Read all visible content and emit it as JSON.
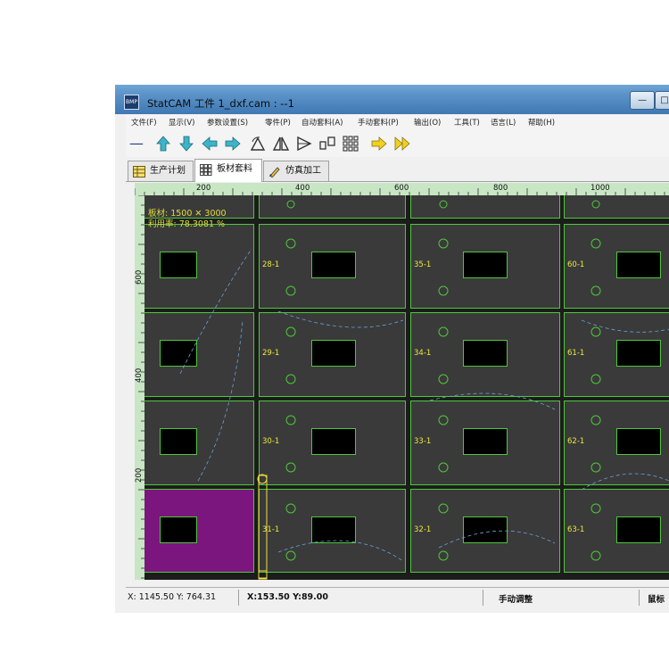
{
  "window": {
    "title": "StatCAM 工件 1_dxf.cam : --1",
    "app_icon_text": "BMP",
    "controls": [
      "—",
      "□"
    ]
  },
  "menu": [
    "文件(F)",
    "显示(V)",
    "参数设置(S)",
    "零件(P)",
    "自动套料(A)",
    "手动套料(P)",
    "输出(O)",
    "工具(T)",
    "语言(L)",
    "帮助(H)"
  ],
  "toolbar": {
    "icons": [
      "minus-icon",
      "arrow-up-icon",
      "arrow-down-icon",
      "arrow-left-icon",
      "arrow-right-icon",
      "rotate-triangle-icon",
      "mirror-horizontal-icon",
      "mirror-vertical-icon",
      "array-icon",
      "grid-icon",
      "step-right-icon",
      "fast-forward-icon"
    ]
  },
  "tabs": [
    {
      "label": "生产计划",
      "icon": "table-icon",
      "active": false
    },
    {
      "label": "板材套料",
      "icon": "grid-icon",
      "active": true
    },
    {
      "label": "仿真加工",
      "icon": "pencil-icon",
      "active": false
    }
  ],
  "ruler": {
    "top": [
      "200",
      "400",
      "600",
      "800",
      "1000"
    ],
    "left": [
      "600",
      "400",
      "200"
    ]
  },
  "sheet_info": {
    "size": "板材: 1500 ✕ 3000",
    "usage": "利用率: 78.3081 %"
  },
  "parts": {
    "col1": [
      "28-1",
      "29-1",
      "30-1",
      "31-1"
    ],
    "col2": [
      "35-1",
      "34-1",
      "33-1",
      "32-1"
    ],
    "col3": [
      "60-1",
      "61-1",
      "62-1",
      "63-1"
    ]
  },
  "status": {
    "coords": "X: 1145.50  Y: 764.31",
    "selection": "X:153.50 Y:89.00",
    "mode": "手动调整",
    "right": "鼠标"
  },
  "colors": {
    "title_gradient": "#5a92c8",
    "canvas": "#1c1c1c",
    "part_fill": "#3a3a3a",
    "part_outline": "#4ec83a",
    "selected_part": "#7a167e",
    "label": "#e8e840",
    "ruler": "#c8e6c4"
  }
}
